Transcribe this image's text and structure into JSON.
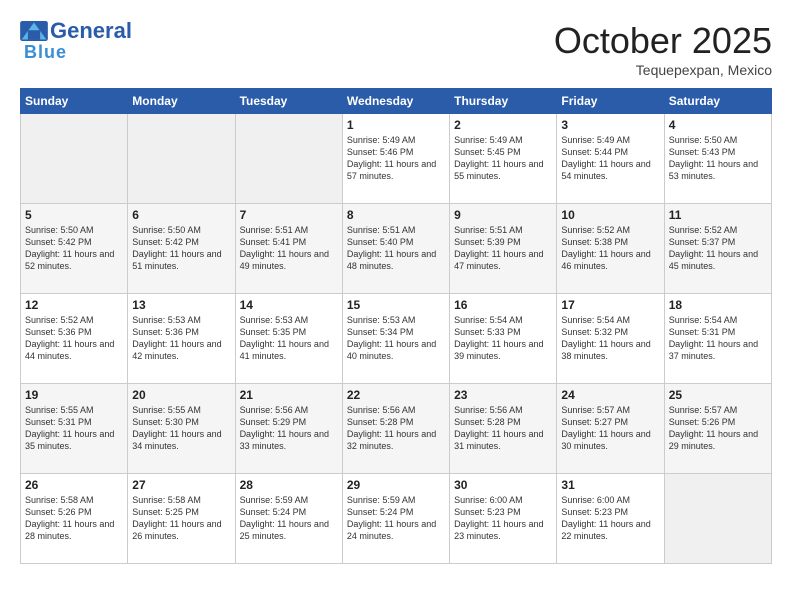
{
  "logo": {
    "line1": "General",
    "line2": "Blue"
  },
  "title": "October 2025",
  "location": "Tequepexpan, Mexico",
  "weekdays": [
    "Sunday",
    "Monday",
    "Tuesday",
    "Wednesday",
    "Thursday",
    "Friday",
    "Saturday"
  ],
  "weeks": [
    [
      {
        "day": "",
        "sunrise": "",
        "sunset": "",
        "daylight": ""
      },
      {
        "day": "",
        "sunrise": "",
        "sunset": "",
        "daylight": ""
      },
      {
        "day": "",
        "sunrise": "",
        "sunset": "",
        "daylight": ""
      },
      {
        "day": "1",
        "sunrise": "Sunrise: 5:49 AM",
        "sunset": "Sunset: 5:46 PM",
        "daylight": "Daylight: 11 hours and 57 minutes."
      },
      {
        "day": "2",
        "sunrise": "Sunrise: 5:49 AM",
        "sunset": "Sunset: 5:45 PM",
        "daylight": "Daylight: 11 hours and 55 minutes."
      },
      {
        "day": "3",
        "sunrise": "Sunrise: 5:49 AM",
        "sunset": "Sunset: 5:44 PM",
        "daylight": "Daylight: 11 hours and 54 minutes."
      },
      {
        "day": "4",
        "sunrise": "Sunrise: 5:50 AM",
        "sunset": "Sunset: 5:43 PM",
        "daylight": "Daylight: 11 hours and 53 minutes."
      }
    ],
    [
      {
        "day": "5",
        "sunrise": "Sunrise: 5:50 AM",
        "sunset": "Sunset: 5:42 PM",
        "daylight": "Daylight: 11 hours and 52 minutes."
      },
      {
        "day": "6",
        "sunrise": "Sunrise: 5:50 AM",
        "sunset": "Sunset: 5:42 PM",
        "daylight": "Daylight: 11 hours and 51 minutes."
      },
      {
        "day": "7",
        "sunrise": "Sunrise: 5:51 AM",
        "sunset": "Sunset: 5:41 PM",
        "daylight": "Daylight: 11 hours and 49 minutes."
      },
      {
        "day": "8",
        "sunrise": "Sunrise: 5:51 AM",
        "sunset": "Sunset: 5:40 PM",
        "daylight": "Daylight: 11 hours and 48 minutes."
      },
      {
        "day": "9",
        "sunrise": "Sunrise: 5:51 AM",
        "sunset": "Sunset: 5:39 PM",
        "daylight": "Daylight: 11 hours and 47 minutes."
      },
      {
        "day": "10",
        "sunrise": "Sunrise: 5:52 AM",
        "sunset": "Sunset: 5:38 PM",
        "daylight": "Daylight: 11 hours and 46 minutes."
      },
      {
        "day": "11",
        "sunrise": "Sunrise: 5:52 AM",
        "sunset": "Sunset: 5:37 PM",
        "daylight": "Daylight: 11 hours and 45 minutes."
      }
    ],
    [
      {
        "day": "12",
        "sunrise": "Sunrise: 5:52 AM",
        "sunset": "Sunset: 5:36 PM",
        "daylight": "Daylight: 11 hours and 44 minutes."
      },
      {
        "day": "13",
        "sunrise": "Sunrise: 5:53 AM",
        "sunset": "Sunset: 5:36 PM",
        "daylight": "Daylight: 11 hours and 42 minutes."
      },
      {
        "day": "14",
        "sunrise": "Sunrise: 5:53 AM",
        "sunset": "Sunset: 5:35 PM",
        "daylight": "Daylight: 11 hours and 41 minutes."
      },
      {
        "day": "15",
        "sunrise": "Sunrise: 5:53 AM",
        "sunset": "Sunset: 5:34 PM",
        "daylight": "Daylight: 11 hours and 40 minutes."
      },
      {
        "day": "16",
        "sunrise": "Sunrise: 5:54 AM",
        "sunset": "Sunset: 5:33 PM",
        "daylight": "Daylight: 11 hours and 39 minutes."
      },
      {
        "day": "17",
        "sunrise": "Sunrise: 5:54 AM",
        "sunset": "Sunset: 5:32 PM",
        "daylight": "Daylight: 11 hours and 38 minutes."
      },
      {
        "day": "18",
        "sunrise": "Sunrise: 5:54 AM",
        "sunset": "Sunset: 5:31 PM",
        "daylight": "Daylight: 11 hours and 37 minutes."
      }
    ],
    [
      {
        "day": "19",
        "sunrise": "Sunrise: 5:55 AM",
        "sunset": "Sunset: 5:31 PM",
        "daylight": "Daylight: 11 hours and 35 minutes."
      },
      {
        "day": "20",
        "sunrise": "Sunrise: 5:55 AM",
        "sunset": "Sunset: 5:30 PM",
        "daylight": "Daylight: 11 hours and 34 minutes."
      },
      {
        "day": "21",
        "sunrise": "Sunrise: 5:56 AM",
        "sunset": "Sunset: 5:29 PM",
        "daylight": "Daylight: 11 hours and 33 minutes."
      },
      {
        "day": "22",
        "sunrise": "Sunrise: 5:56 AM",
        "sunset": "Sunset: 5:28 PM",
        "daylight": "Daylight: 11 hours and 32 minutes."
      },
      {
        "day": "23",
        "sunrise": "Sunrise: 5:56 AM",
        "sunset": "Sunset: 5:28 PM",
        "daylight": "Daylight: 11 hours and 31 minutes."
      },
      {
        "day": "24",
        "sunrise": "Sunrise: 5:57 AM",
        "sunset": "Sunset: 5:27 PM",
        "daylight": "Daylight: 11 hours and 30 minutes."
      },
      {
        "day": "25",
        "sunrise": "Sunrise: 5:57 AM",
        "sunset": "Sunset: 5:26 PM",
        "daylight": "Daylight: 11 hours and 29 minutes."
      }
    ],
    [
      {
        "day": "26",
        "sunrise": "Sunrise: 5:58 AM",
        "sunset": "Sunset: 5:26 PM",
        "daylight": "Daylight: 11 hours and 28 minutes."
      },
      {
        "day": "27",
        "sunrise": "Sunrise: 5:58 AM",
        "sunset": "Sunset: 5:25 PM",
        "daylight": "Daylight: 11 hours and 26 minutes."
      },
      {
        "day": "28",
        "sunrise": "Sunrise: 5:59 AM",
        "sunset": "Sunset: 5:24 PM",
        "daylight": "Daylight: 11 hours and 25 minutes."
      },
      {
        "day": "29",
        "sunrise": "Sunrise: 5:59 AM",
        "sunset": "Sunset: 5:24 PM",
        "daylight": "Daylight: 11 hours and 24 minutes."
      },
      {
        "day": "30",
        "sunrise": "Sunrise: 6:00 AM",
        "sunset": "Sunset: 5:23 PM",
        "daylight": "Daylight: 11 hours and 23 minutes."
      },
      {
        "day": "31",
        "sunrise": "Sunrise: 6:00 AM",
        "sunset": "Sunset: 5:23 PM",
        "daylight": "Daylight: 11 hours and 22 minutes."
      },
      {
        "day": "",
        "sunrise": "",
        "sunset": "",
        "daylight": ""
      }
    ]
  ]
}
